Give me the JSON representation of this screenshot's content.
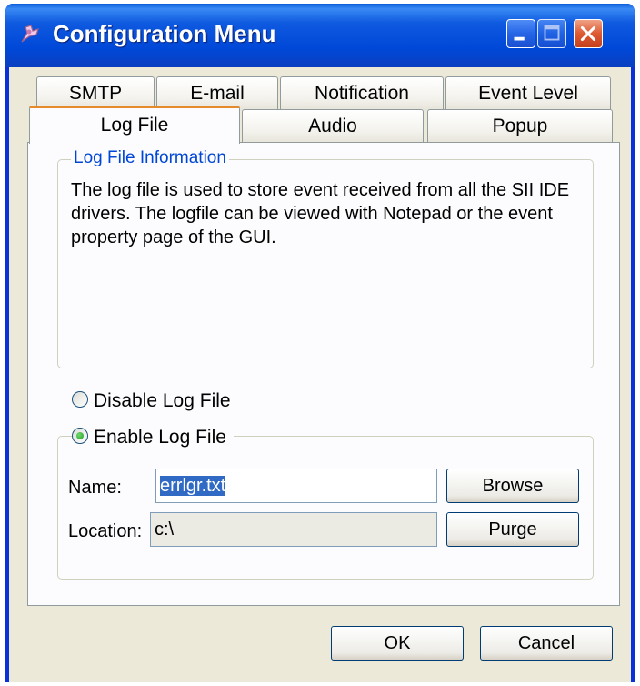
{
  "window": {
    "title": "Configuration Menu"
  },
  "tabs": {
    "row1": [
      "SMTP",
      "E-mail",
      "Notification",
      "Event Level"
    ],
    "row2": [
      "Log File",
      "Audio",
      "Popup"
    ],
    "active": "Log File"
  },
  "log_info": {
    "title": "Log File Information",
    "text": "The log file is used to store event received from all the SII IDE drivers. The logfile can be viewed with Notepad or the event property page of the GUI."
  },
  "options": {
    "disable_label": "Disable Log File",
    "enable_label": "Enable  Log File",
    "selected": "enable"
  },
  "fields": {
    "name_label": "Name:",
    "name_value": "errlgr.txt",
    "location_label": "Location:",
    "location_value": "c:\\"
  },
  "buttons": {
    "browse": "Browse",
    "purge": "Purge",
    "ok": "OK",
    "cancel": "Cancel"
  },
  "icons": {
    "app": "configuration-app-icon",
    "minimize": "minimize-icon",
    "maximize": "maximize-icon",
    "close": "close-icon"
  },
  "colors": {
    "titlebar": "#0a4fdc",
    "accent_tab": "#e68b2c",
    "group_title": "#0046d5",
    "selection": "#316ac5"
  }
}
